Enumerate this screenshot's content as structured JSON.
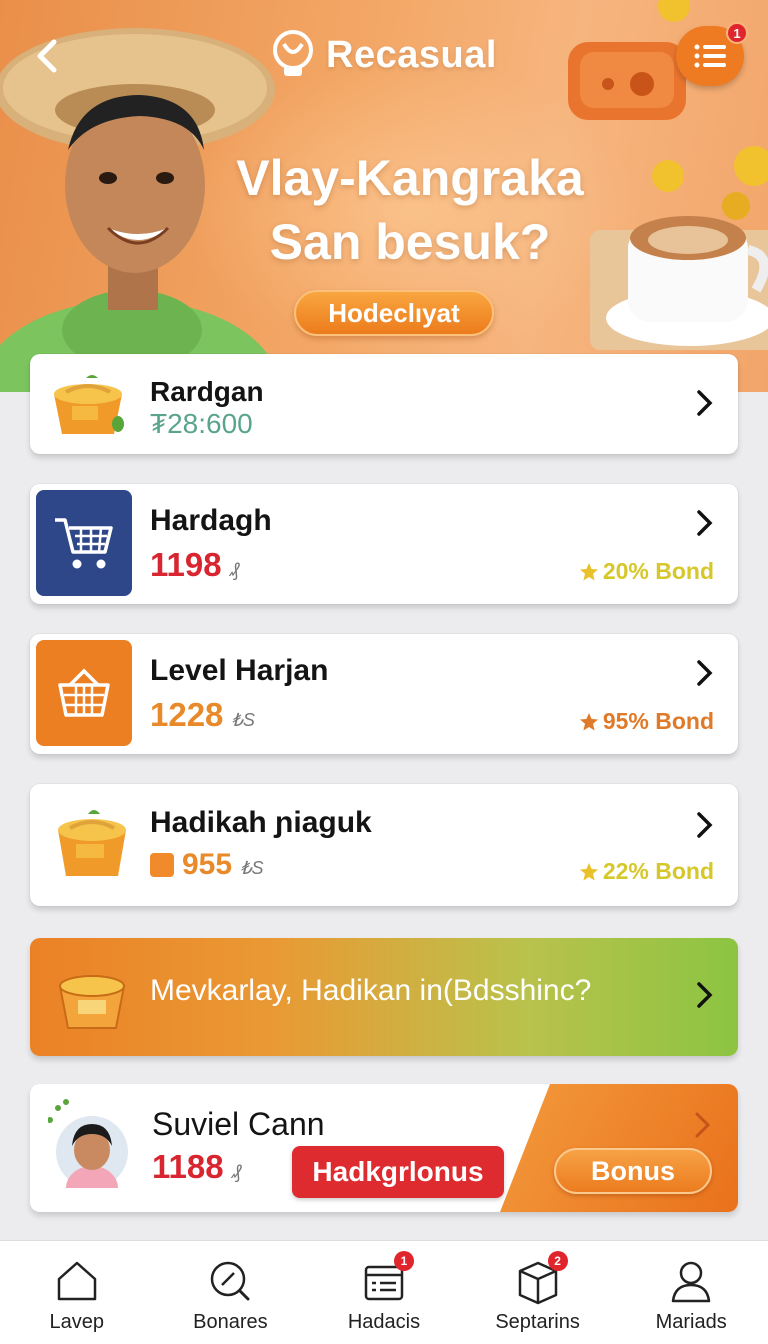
{
  "header": {
    "brand": "Recasual",
    "menu_badge": "1",
    "title_line1": "Vlay-Kangraka",
    "title_line2": "San besuk?",
    "cta": "Hodeclıyat"
  },
  "cards": [
    {
      "title": "Rardgan",
      "price": "₮28:600",
      "unit": "",
      "bond": ""
    },
    {
      "title": "Hardagh",
      "price": "1198",
      "unit": "₰",
      "bond": "20% Bond"
    },
    {
      "title": "Level Harjan",
      "price": "1228",
      "unit": "₺S",
      "bond": "95% Bond"
    },
    {
      "title": "Hadikah ɲiaguk",
      "price": "955",
      "unit": "₺S",
      "bond": "22% Bond"
    }
  ],
  "promo": {
    "text": "Mevkarlay, Hadikan in(Bdsshinc?"
  },
  "user_card": {
    "name": "Suviel Cann",
    "price": "1188",
    "unit": "₰",
    "red_button": "Hadkgrlonus",
    "bonus_button": "Bonus"
  },
  "nav": [
    {
      "label": "Lavep",
      "badge": ""
    },
    {
      "label": "Bonares",
      "badge": ""
    },
    {
      "label": "Hadacis",
      "badge": "1"
    },
    {
      "label": "Septarins",
      "badge": "2"
    },
    {
      "label": "Mariads",
      "badge": ""
    }
  ],
  "colors": {
    "accent": "#ee7a22",
    "price_red": "#d92530",
    "price_orange": "#e8892a",
    "bond_yellow": "#d6c82a",
    "navy_tile": "#2d4788"
  }
}
